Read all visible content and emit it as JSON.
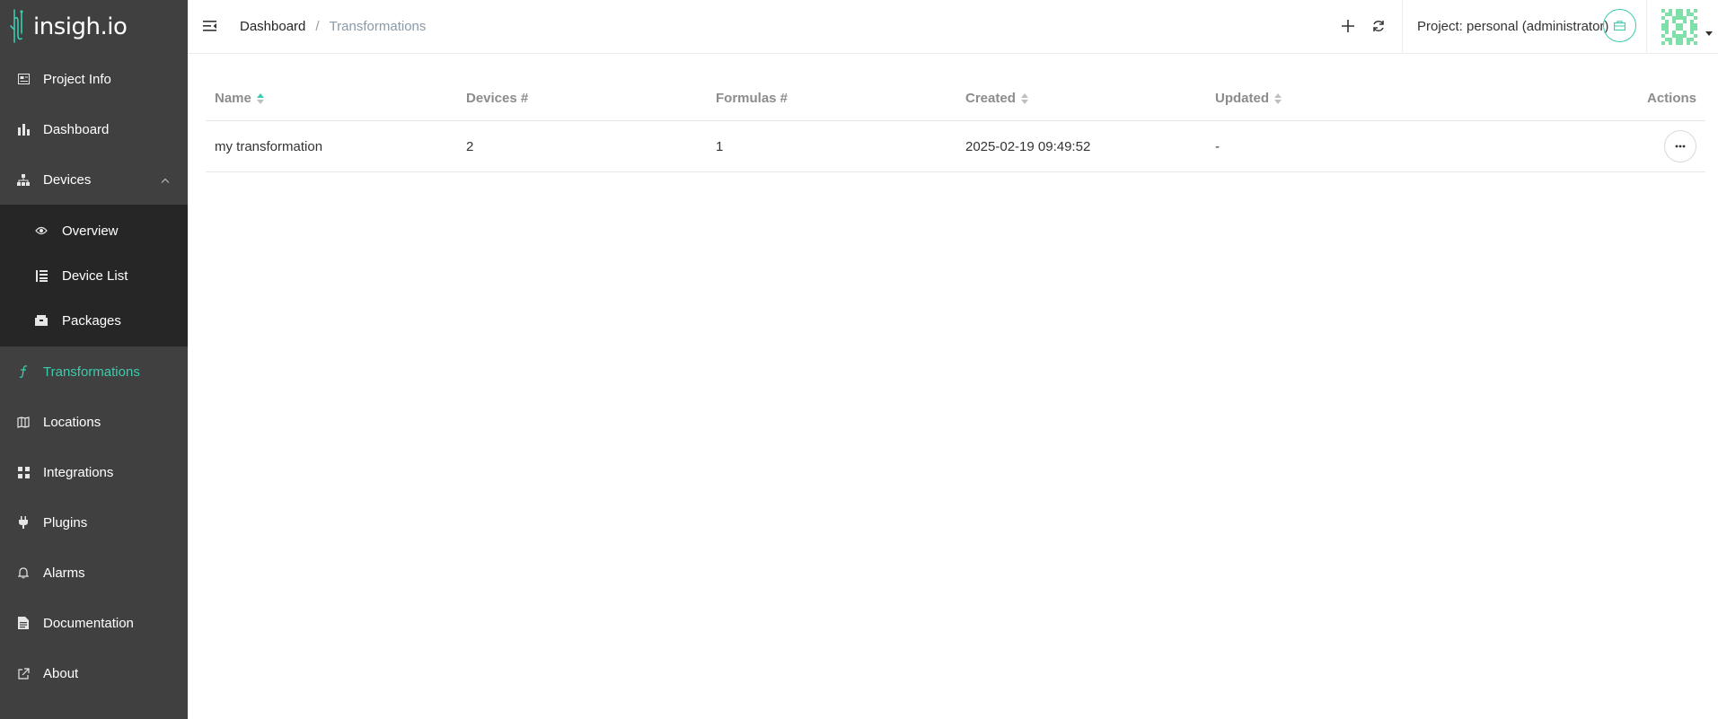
{
  "brand": {
    "name": "insigh.io"
  },
  "sidebar": {
    "items": [
      {
        "label": "Project Info",
        "icon": "project-info-icon"
      },
      {
        "label": "Dashboard",
        "icon": "bar-chart-icon"
      },
      {
        "label": "Devices",
        "icon": "devices-tree-icon",
        "expanded": true,
        "children": [
          {
            "label": "Overview",
            "icon": "eye-icon"
          },
          {
            "label": "Device List",
            "icon": "list-icon"
          },
          {
            "label": "Packages",
            "icon": "package-icon"
          }
        ]
      },
      {
        "label": "Transformations",
        "icon": "function-icon",
        "active": true
      },
      {
        "label": "Locations",
        "icon": "map-icon"
      },
      {
        "label": "Integrations",
        "icon": "grid-icon"
      },
      {
        "label": "Plugins",
        "icon": "plug-icon"
      },
      {
        "label": "Alarms",
        "icon": "bell-icon"
      },
      {
        "label": "Documentation",
        "icon": "document-icon"
      },
      {
        "label": "About",
        "icon": "external-link-icon"
      }
    ]
  },
  "header": {
    "breadcrumb": {
      "root": "Dashboard",
      "separator": "/",
      "current": "Transformations"
    },
    "project_label": "Project: personal (administrator)"
  },
  "table": {
    "columns": {
      "name": "Name",
      "devices": "Devices #",
      "formulas": "Formulas #",
      "created": "Created",
      "updated": "Updated",
      "actions": "Actions"
    },
    "rows": [
      {
        "name": "my transformation",
        "devices": "2",
        "formulas": "1",
        "created": "2025-02-19 09:49:52",
        "updated": "-"
      }
    ]
  },
  "colors": {
    "accent": "#3ccbae",
    "sidebar_bg": "#404040",
    "submenu_bg": "#262626"
  }
}
